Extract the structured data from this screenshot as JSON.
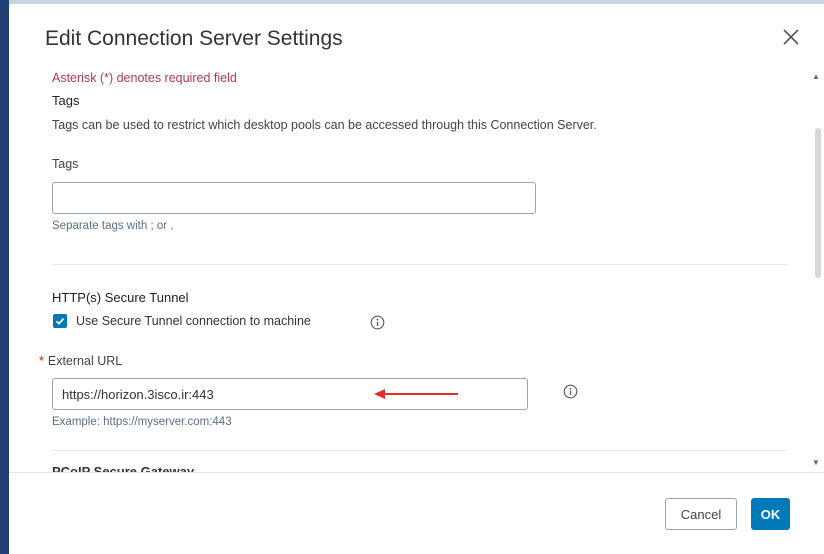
{
  "dialog": {
    "title": "Edit Connection Server Settings"
  },
  "form": {
    "required_note": "Asterisk (*) denotes required field",
    "tags_section": {
      "title": "Tags",
      "description": "Tags can be used to restrict which desktop pools can be accessed through this Connection Server.",
      "field_label": "Tags",
      "value": "",
      "helper": "Separate tags with ; or ,"
    },
    "secure_tunnel": {
      "title": "HTTP(s) Secure Tunnel",
      "checkbox_label": "Use Secure Tunnel connection to machine",
      "checked": true,
      "external_url_label": "External URL",
      "required_mark": "*",
      "external_url_value": "https://horizon.3isco.ir:443",
      "external_url_helper": "Example: https://myserver.com:443"
    },
    "next_section_title_partial": "PCoIP Secure Gateway"
  },
  "footer": {
    "cancel_label": "Cancel",
    "ok_label": "OK"
  },
  "colors": {
    "primary": "#0079b8",
    "required": "#b0375a",
    "annotation_arrow": "#e0302a"
  },
  "icons": {
    "close": "close-icon",
    "info": "info-icon",
    "check": "checkmark-icon"
  }
}
